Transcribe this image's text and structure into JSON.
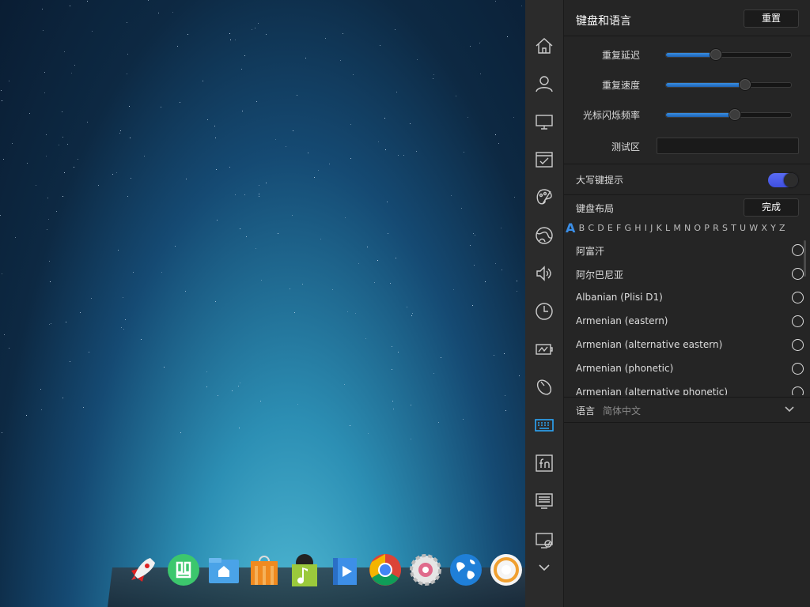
{
  "panel": {
    "title": "键盘和语言",
    "reset_label": "重置",
    "sliders": [
      {
        "label": "重复延迟",
        "value_percent": 40
      },
      {
        "label": "重复速度",
        "value_percent": 63
      },
      {
        "label": "光标闪烁频率",
        "value_percent": 55
      }
    ],
    "test_area_label": "测试区",
    "test_area_value": "",
    "caps_lock_label": "大写键提示",
    "caps_lock_on": true,
    "layout_label": "键盘布局",
    "done_label": "完成",
    "alphabet": [
      "A",
      "B",
      "C",
      "D",
      "E",
      "F",
      "G",
      "H",
      "I",
      "J",
      "K",
      "L",
      "M",
      "N",
      "O",
      "P",
      "R",
      "S",
      "T",
      "U",
      "W",
      "X",
      "Y",
      "Z"
    ],
    "active_letter": "A",
    "layouts": [
      "阿富汗",
      "阿尔巴尼亚",
      "Albanian (Plisi D1)",
      "Armenian (eastern)",
      "Armenian (alternative eastern)",
      "Armenian (phonetic)",
      "Armenian (alternative phonetic)"
    ],
    "language_label": "语言",
    "language_value": "简体中文"
  },
  "sidebar": {
    "icons": [
      "home-icon",
      "account-icon",
      "display-icon",
      "default-apps-icon",
      "personalization-icon",
      "network-icon",
      "sound-icon",
      "time-icon",
      "power-icon",
      "mouse-icon",
      "keyboard-icon",
      "hotkey-icon",
      "system-info-icon",
      "update-icon",
      "chevron-down-icon"
    ],
    "active": "keyboard-icon",
    "accent": "#2ca7f8"
  },
  "dock": {
    "apps": [
      "launcher-icon",
      "deepin-store-icon",
      "file-manager-icon",
      "app-store-icon",
      "music-icon",
      "movie-icon",
      "chrome-icon",
      "control-center-icon",
      "browser-icon",
      "screen-recorder-icon"
    ]
  }
}
